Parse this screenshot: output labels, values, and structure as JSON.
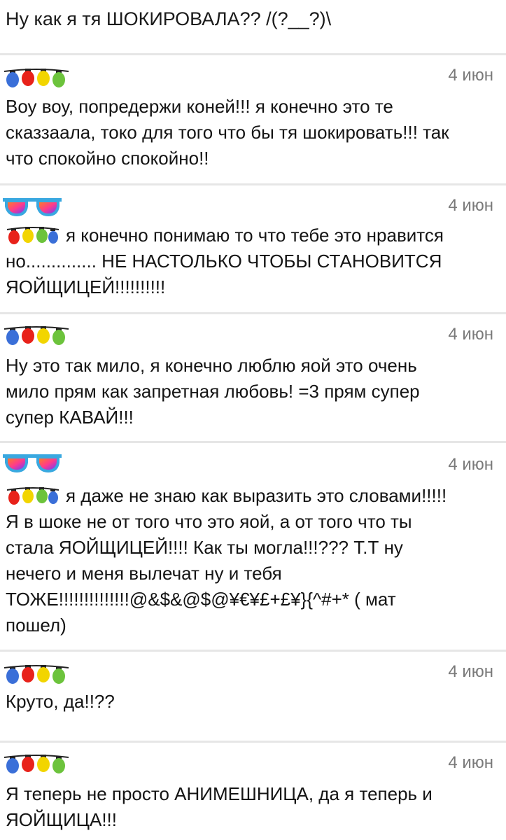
{
  "header": {
    "text": "Ну как я тя ШОКИРОВАЛА?? /(?__?)\\"
  },
  "colors": {
    "blue": "#3a6fd8",
    "red": "#e8221a",
    "yellow": "#f2d500",
    "green": "#6cc33c",
    "separator": "#e6e6e6",
    "date": "#7a7a7a"
  },
  "comments": [
    {
      "avatar": "lights-garland-icon",
      "date": "4 июн",
      "text": "Воу воу, попредержи коней!!! я конечно это те сказзаала, токо для того что бы тя шокировать!!! так что спокойно спокойно!!"
    },
    {
      "avatar": "sunglasses-icon",
      "date": "4 июн",
      "text": "я конечно понимаю то что тебе это нравится но.............. НЕ НАСТОЛЬКО ЧТОБЫ СТАНОВИТСЯ ЯОЙЩИЦЕЙ!!!!!!!!!!"
    },
    {
      "avatar": "lights-garland-icon",
      "date": "4 июн",
      "text": "Ну это так мило, я конечно люблю яой это очень мило прям как запретная любовь! =3 прям супер супер КАВАЙ!!!"
    },
    {
      "avatar": "sunglasses-icon",
      "date": "4 июн",
      "text": "я даже не знаю как выразить это словами!!!!! Я в шоке не от того что это яой, а от того что ты стала ЯОЙЩИЦЕЙ!!!! Как ты могла!!!??? Т.Т ну нечего и меня вылечат ну и тебя ТОЖЕ!!!!!!!!!!!!!!@&$&@$@¥€¥£+£¥}{^#+* ( мат пошел)"
    },
    {
      "avatar": "lights-garland-icon",
      "date": "4 июн",
      "text": "Круто, да!!??"
    },
    {
      "avatar": "lights-garland-icon",
      "date": "4 июн",
      "text": "Я теперь не просто АНИМЕШНИЦА, да я теперь и ЯОЙЩИЦА!!!"
    }
  ]
}
